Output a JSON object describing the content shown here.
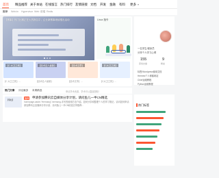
{
  "nav": {
    "items": [
      "首页",
      "精品推荐",
      "关于本站",
      "在线留言",
      "热门排行",
      "友情链接",
      "文档",
      "开发",
      "金融",
      "有料",
      "更多"
    ],
    "active_index": 0,
    "accent": "#fc5531"
  },
  "subnav": {
    "items": [
      "推荐",
      "Weixin",
      "Hypervisor",
      "Web",
      "前端",
      "Redis"
    ],
    "active_index": 0
  },
  "hero": {
    "carousel_title": "【赛事】热门比赛正在火热报名中，企业新赛事继续推出活动",
    "side_label": "Linux 指令"
  },
  "cards": [
    {
      "tag": "【C 大卫之死】",
      "caption": "【C 大卫之死】...",
      "color": "#d3e3ff"
    },
    {
      "tag": "【技术名人最新】",
      "caption": "【技术名人最新】",
      "color": "#c9d1f2"
    },
    {
      "tag": "【技术文章】",
      "caption": "【技术文章】...",
      "color": "#ffe8d9"
    },
    {
      "tag": "【C大卫之死】",
      "caption": "【C大卫之死】...",
      "color": "#e6f0ff"
    }
  ],
  "tabs": {
    "items": [
      "热门文章",
      "评论最多",
      "本周精选"
    ],
    "active_index": 0,
    "note": "申请学术资源，学术可以直接提取！"
  },
  "article": {
    "thumb_text": "【专栏】",
    "badge": "推荐",
    "title": "申请参加腾讯云自媒体分享计划，请问鱼儿一半CN精选",
    "desc": "homepage-aside-“Hermang”-hermang-手写的使用方法介绍。如何分享和整理个人的学习笔记，请问如何申请参加腾讯云自媒体分享计划，请问鱼儿一半CN精选文章推荐..."
  },
  "profile": {
    "lines": [
      "一名学生/程序员",
      "分享个人学习心得"
    ],
    "stats": [
      {
        "num": "155",
        "label": "原创文章"
      },
      {
        "num": "9",
        "label": "粉丝"
      }
    ],
    "desc_lines": [
      "标签/Wordpress使用文档",
      "Hermes个人博客网站",
      "Chief运维教程",
      "Python运维教程"
    ]
  },
  "hotlist": {
    "title": "热门标签",
    "bars": [
      {
        "color": "#3fa47b",
        "value": 0.82
      },
      {
        "color": "#fc5531",
        "value": 0.75
      },
      {
        "color": "#3fa47b",
        "value": 0.7
      },
      {
        "color": "#fc5531",
        "value": 0.64
      },
      {
        "color": "#3fa47b",
        "value": 0.58
      },
      {
        "color": "#fc5531",
        "value": 0.52
      },
      {
        "color": "#3fa47b",
        "value": 0.45
      }
    ]
  }
}
